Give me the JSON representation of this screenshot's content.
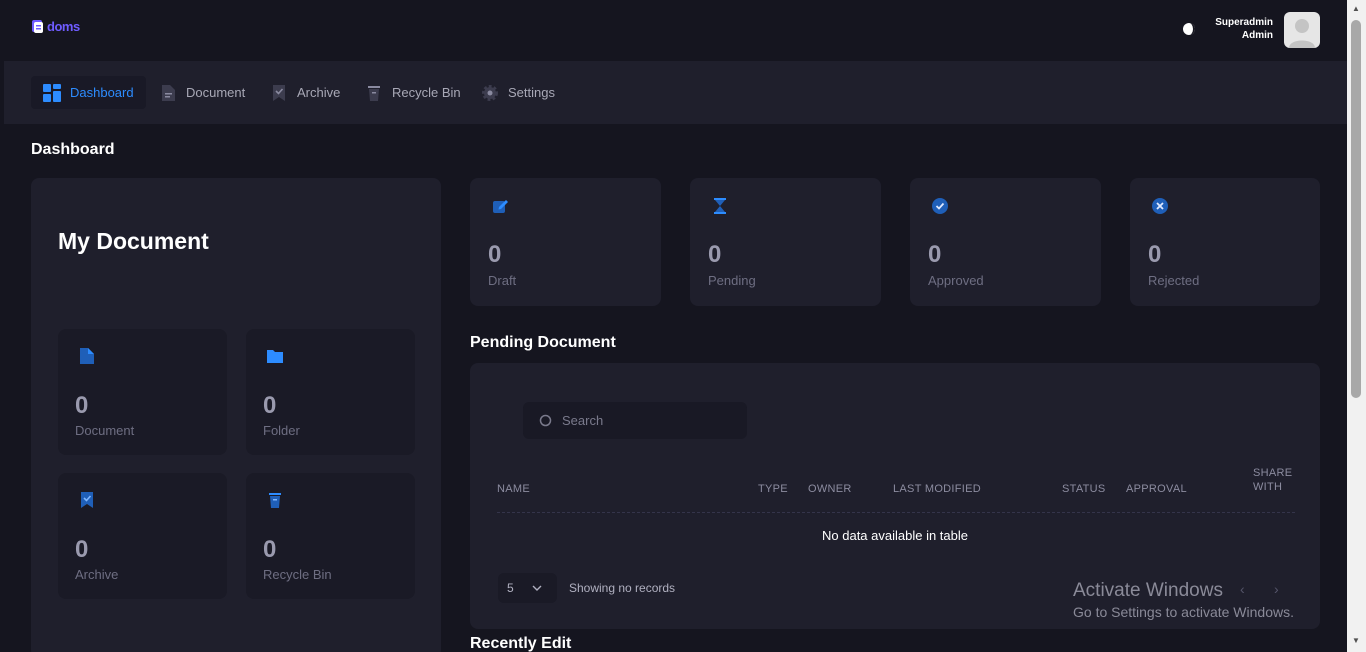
{
  "app": {
    "logo_text": "doms"
  },
  "user": {
    "name": "Superadmin",
    "role": "Admin"
  },
  "nav": {
    "items": [
      {
        "label": "Dashboard",
        "active": true,
        "icon": "grid-icon"
      },
      {
        "label": "Document",
        "active": false,
        "icon": "document-icon"
      },
      {
        "label": "Archive",
        "active": false,
        "icon": "archive-icon"
      },
      {
        "label": "Recycle Bin",
        "active": false,
        "icon": "trash-icon"
      },
      {
        "label": "Settings",
        "active": false,
        "icon": "gear-icon"
      }
    ]
  },
  "page": {
    "title": "Dashboard"
  },
  "my_document": {
    "title": "My Document",
    "tiles": [
      {
        "value": "0",
        "label": "Document",
        "icon": "document-icon"
      },
      {
        "value": "0",
        "label": "Folder",
        "icon": "folder-icon"
      },
      {
        "value": "0",
        "label": "Archive",
        "icon": "archive-icon"
      },
      {
        "value": "0",
        "label": "Recycle Bin",
        "icon": "trash-icon"
      }
    ]
  },
  "stats": [
    {
      "value": "0",
      "label": "Draft",
      "icon": "edit-icon"
    },
    {
      "value": "0",
      "label": "Pending",
      "icon": "hourglass-icon"
    },
    {
      "value": "0",
      "label": "Approved",
      "icon": "check-circle-icon"
    },
    {
      "value": "0",
      "label": "Rejected",
      "icon": "x-circle-icon"
    }
  ],
  "pending": {
    "title": "Pending Document",
    "search_placeholder": "Search",
    "columns": [
      "NAME",
      "TYPE",
      "OWNER",
      "LAST MODIFIED",
      "STATUS",
      "APPROVAL",
      "SHARE",
      "WITH"
    ],
    "empty_text": "No data available in table",
    "page_size": "5",
    "records_text": "Showing no records",
    "prev": "‹",
    "next": "›"
  },
  "recently": {
    "title": "Recently Edit"
  },
  "watermark": {
    "line1": "Activate Windows",
    "line2": "Go to Settings to activate Windows."
  },
  "colors": {
    "accent": "#2d8cff",
    "background": "#15151f",
    "card": "#1f1f2c"
  }
}
